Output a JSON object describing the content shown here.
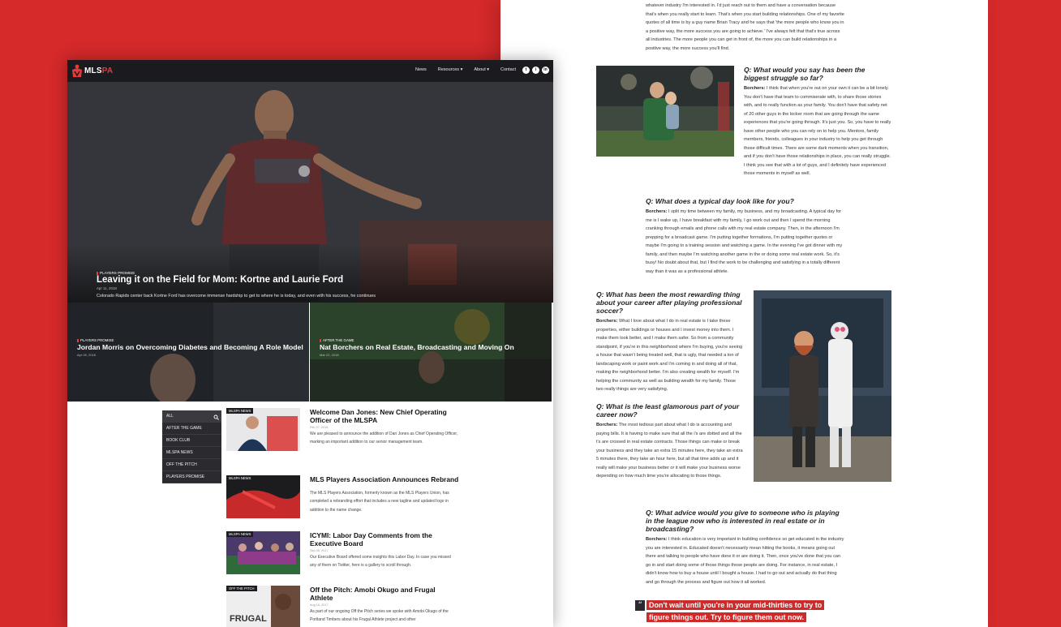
{
  "site": {
    "brand": {
      "prefix": "MLS",
      "accent": "PA"
    },
    "nav": [
      "News",
      "Resources",
      "About",
      "Contact"
    ],
    "social": [
      "t",
      "i",
      "in"
    ],
    "hero": {
      "category": "PLAYERS PROMISE",
      "title": "Leaving it on the Field for Mom: Kortne and Laurie Ford",
      "date": "Apr 11, 2018",
      "description": "Colorado Rapids center back Kortne Ford has overcome immense hardship to get to where he is today, and even with his success, he continues to be tested."
    },
    "cards": [
      {
        "category": "PLAYERS PROMISE",
        "title": "Jordan Morris on Overcoming Diabetes and Becoming A Role Model",
        "date": "Apr 09, 2018"
      },
      {
        "category": "AFTER THE GAME",
        "title": "Nat Borchers on Real Estate, Broadcasting and Moving On",
        "date": "Mar 22, 2018"
      }
    ],
    "categories": [
      "ALL",
      "AFTER THE GAME",
      "BOOK CLUB",
      "MLSPA NEWS",
      "OFF THE PITCH",
      "PLAYERS PROMISE"
    ],
    "posts": [
      {
        "tag": "MLSPA NEWS",
        "title": "Welcome Dan Jones: New Chief Operating Officer of the MLSPA",
        "date": "Feb 07, 2018",
        "description": "We are pleased to announce the addition of Dan Jones as Chief Operating Officer, marking an important addition to our senior management team."
      },
      {
        "tag": "MLSPA NEWS",
        "title": "MLS Players Association Announces Rebrand",
        "date": "",
        "description": "The MLS Players Association, formerly known as the MLS Players Union, has completed a rebranding effort that includes a new tagline and updated logo in addition to the name change."
      },
      {
        "tag": "MLSPA NEWS",
        "title": "ICYMI: Labor Day Comments from the Executive Board",
        "date": "Sep 05, 2017",
        "description": "Our Executive Board offered some insights this Labor Day. In case you missed any of them on Twitter, here is a gallery to scroll through."
      },
      {
        "tag": "OFF THE PITCH",
        "title": "Off the Pitch: Amobi Okugo and Frugal Athlete",
        "date": "Aug 16, 2017",
        "description": "As part of our ongoing Off the Pitch series we spoke with Amobi Okugo of the Portland Timbers about his Frugal Athlete project and other"
      }
    ]
  },
  "article": {
    "intro": "whatever industry I'm interested in. I'd just reach out to them and have a conversation because that's when you really start to learn. That's when you start building relationships. One of my favorite quotes of all time is by a guy name Brian Tracy and he says that 'the more people who know you in a positive way, the more success you are going to achieve.' I've always felt that that's true across all industries. The more people you can get in front of, the more you can build relationships in a positive way, the more success you'll find.",
    "qa": [
      {
        "q": "Q: What would you say has been the biggest struggle so far?",
        "speaker": "Borchers:",
        "a": "I think that when you're out on your own it can be a bit lonely. You don't have that team to commiserate with, to share those stories with, and to really function as your family. You don't have that safety net of 20 other guys in the locker room that are going through the same experiences that you're going through. It's just you. So, you have to really have other people who you can rely on to help you. Mentors, family members, friends, colleagues in your industry to help you get through those difficult times. There are some dark moments when you transition, and if you don't have those relationships in place, you can really struggle. I think you see that with a lot of guys, and I definitely have experienced those moments in myself as well."
      },
      {
        "q": "Q: What does a typical day look like for you?",
        "speaker": "Borchers:",
        "a": "I split my time between my family, my business, and my broadcasting. A typical day for me is I wake up, I have breakfast with my family, I go work out and then I spend the morning cranking through emails and phone calls with my real estate company. Then, in the afternoon I'm prepping for a broadcast game. I'm putting together formations, I'm putting together quotes or maybe I'm going to a training session and watching a game. In the evening I've got dinner with my family, and then maybe I'm watching another game in the or doing some real estate work.  So, it's busy! No doubt about that, but I find the work to be challenging and satisfying in a totally different way than it was as a professional athlete."
      },
      {
        "q": "Q: What has been the most rewarding thing about your career after playing professional soccer?",
        "speaker": "Borchers:",
        "a": "What I love about what I do in real estate is I take these properties, either buildings or houses and I invest money into them. I make them look better, and I make them safer. So from a community standpoint, if you're in this neighborhood where I'm buying, you're seeing a house that wasn't being treated well, that is ugly, that needed a ton of landscaping work or paint work and I'm coming in and doing all of that, making the neighborhood better. I'm also creating wealth for myself. I'm helping the community as well as building wealth for my family. Those two really things are very satisfying."
      },
      {
        "q": "Q: What is the least glamorous part of your career now?",
        "speaker": "Borchers:",
        "a": "The most tedious part about what I do is accounting and paying bills. It is having to make sure that all the i's are dotted and all the t's are crossed in real estate contracts. Those things can make or break your business and they take an extra 15 minutes here, they take an extra 5 minutes there, they take an hour here, but all that time adds up and it really will make your business better or it will make your business worse depending on how much time you're allocating to those things."
      },
      {
        "q": "Q: What advice would you give to someone who is playing in the league now who is interested in real estate or in broadcasting?",
        "speaker": "Borchers:",
        "a": "I think education is very important in building confidence so get educated in the industry you are interested in. Educated doesn't necessarily mean hitting the books, it means going out there and talking to people who have done it or are doing it. Then, once you've done that you can go in and start doing some of those things those people are doing. For instance, in real estate, I didn't know how to buy a house until I bought a house. I had to go out and actually do that thing and go through the process and figure out how it all worked."
      }
    ],
    "pullquote": "Don't wait until you're in your mid-thirties to try to figure things out. Try to figure them out now."
  },
  "colors": {
    "brand_red": "#d5292a",
    "nav_dark": "#1b1b1f"
  }
}
